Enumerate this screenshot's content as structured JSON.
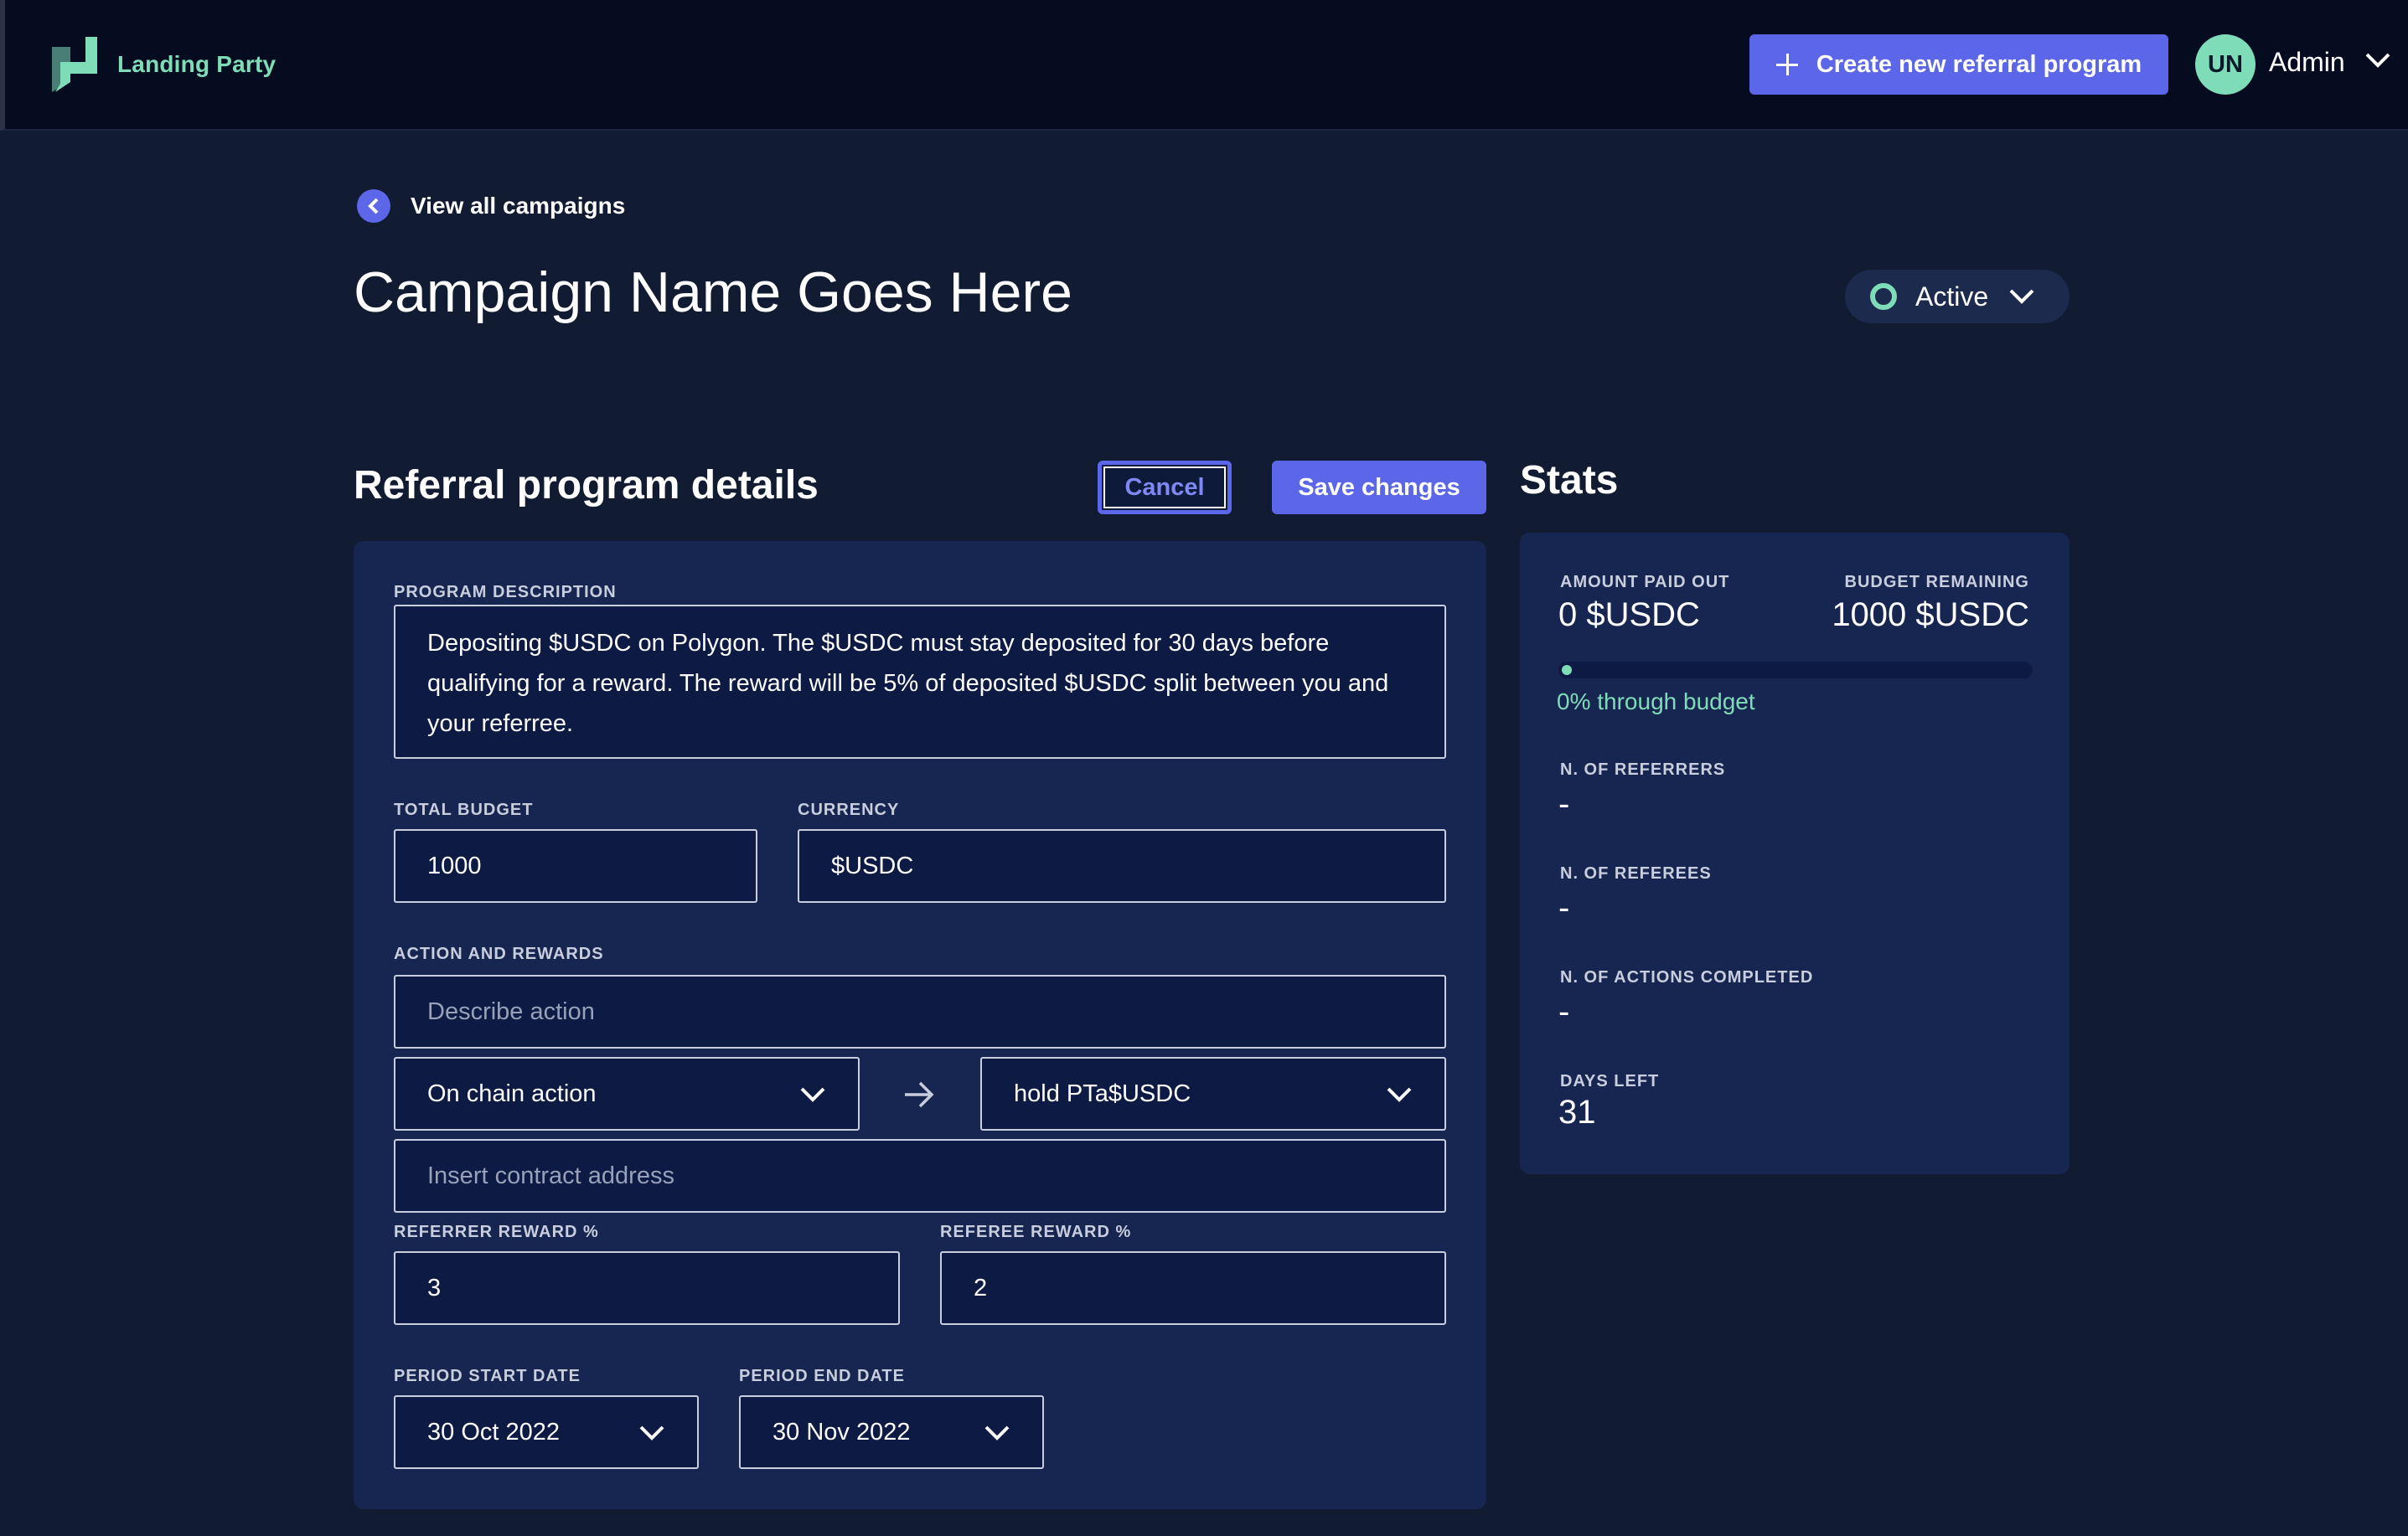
{
  "app": {
    "brand_name": "Landing Party"
  },
  "header": {
    "create_button_label": "Create new referral program",
    "avatar_initials": "UN",
    "user_label": "Admin"
  },
  "page": {
    "back_link_label": "View all campaigns",
    "title": "Campaign Name Goes Here",
    "status": "Active"
  },
  "details": {
    "section_title": "Referral program details",
    "cancel_label": "Cancel",
    "save_label": "Save changes",
    "description_label": "PROGRAM DESCRIPTION",
    "description_value": "Depositing $USDC on Polygon. The $USDC must stay deposited for 30 days before qualifying for a reward. The reward will be 5% of deposited $USDC split between you and your referree.",
    "total_budget_label": "TOTAL BUDGET",
    "total_budget_value": "1000",
    "currency_label": "CURRENCY",
    "currency_value": "$USDC",
    "action_rewards_label": "ACTION AND REWARDS",
    "describe_action_placeholder": "Describe action",
    "action_type_value": "On chain action",
    "action_target_value": "hold PTa$USDC",
    "contract_address_placeholder": "Insert contract address",
    "referrer_reward_label": "REFERRER REWARD %",
    "referrer_reward_value": "3",
    "referee_reward_label": "REFEREE REWARD %",
    "referee_reward_value": "2",
    "start_date_label": "PERIOD START DATE",
    "start_date_value": "30 Oct 2022",
    "end_date_label": "PERIOD END DATE",
    "end_date_value": "30 Nov 2022"
  },
  "stats": {
    "section_title": "Stats",
    "amount_paid_label": "AMOUNT PAID OUT",
    "amount_paid_value": "0 $USDC",
    "budget_remaining_label": "BUDGET REMAINING",
    "budget_remaining_value": "1000 $USDC",
    "budget_progress_fraction": 0,
    "progress_text": "0% through budget",
    "referrers_label": "N. OF REFERRERS",
    "referrers_value": "-",
    "referees_label": "N. OF REFEREES",
    "referees_value": "-",
    "actions_label": "N. OF ACTIONS COMPLETED",
    "actions_value": "-",
    "days_left_label": "DAYS LEFT",
    "days_left_value": "31"
  },
  "colors": {
    "accent": "#5b67e8",
    "brand_green": "#7fdcb8",
    "background": "#111b31",
    "card": "#172650",
    "input": "#0c1a44"
  },
  "icons": [
    "logo-icon",
    "plus-icon",
    "chevron-down-icon",
    "chevron-left-icon",
    "status-ring-icon",
    "arrow-right-icon"
  ]
}
